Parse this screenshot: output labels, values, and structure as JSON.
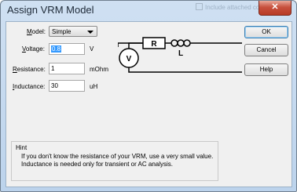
{
  "window": {
    "title": "Assign VRM Model",
    "background_text": "Include attached cor",
    "close_label": "✕"
  },
  "form": {
    "model": {
      "label_prefix": "",
      "label_accel": "M",
      "label_rest": "odel:",
      "value": "Simple"
    },
    "voltage": {
      "label_accel": "V",
      "label_rest": "oltage:",
      "value": "0.8",
      "unit": "V"
    },
    "resistance": {
      "label_accel": "R",
      "label_rest": "esistance:",
      "value": "1",
      "unit": "mOhm"
    },
    "inductance": {
      "label_accel": "I",
      "label_rest": "nductance:",
      "value": "30",
      "unit": "uH"
    }
  },
  "buttons": {
    "ok": "OK",
    "cancel": "Cancel",
    "help": "Help"
  },
  "diagram": {
    "resistor_label": "R",
    "inductor_label": "L",
    "source_label": "V"
  },
  "hint": {
    "title": "Hint",
    "text": "If you don't know the resistance of your VRM, use a very small value. Inductance is needed only for transient or AC analysis."
  },
  "colors": {
    "selection": "#3399ff",
    "title_bar": "#cfe0f2",
    "close_button": "#c8513e"
  }
}
